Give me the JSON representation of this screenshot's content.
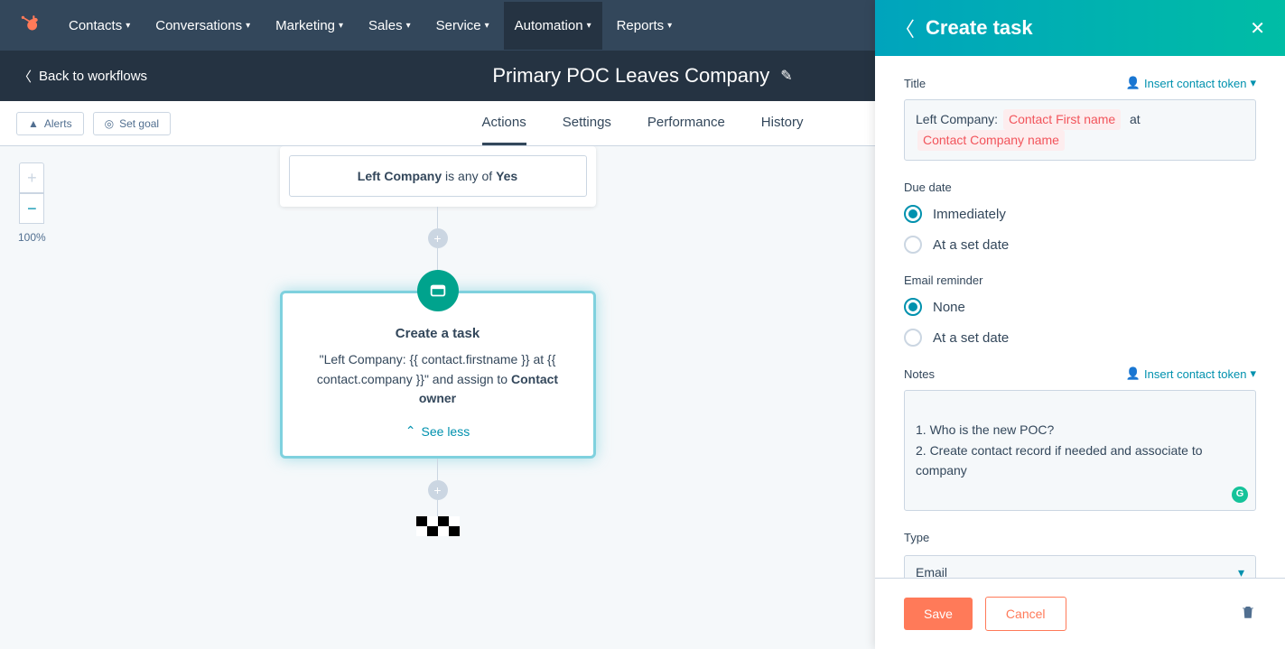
{
  "nav": {
    "items": [
      {
        "label": "Contacts"
      },
      {
        "label": "Conversations"
      },
      {
        "label": "Marketing"
      },
      {
        "label": "Sales"
      },
      {
        "label": "Service"
      },
      {
        "label": "Automation"
      },
      {
        "label": "Reports"
      }
    ]
  },
  "subheader": {
    "back": "Back to workflows",
    "title": "Primary POC Leaves Company"
  },
  "toolbar": {
    "alerts": "Alerts",
    "set_goal": "Set goal",
    "tabs": [
      {
        "label": "Actions"
      },
      {
        "label": "Settings"
      },
      {
        "label": "Performance"
      },
      {
        "label": "History"
      }
    ]
  },
  "zoom": {
    "pct": "100%"
  },
  "flow": {
    "trigger_prefix": "Left Company",
    "trigger_mid": " is any of ",
    "trigger_value": "Yes",
    "action_title": "Create a task",
    "action_quote": "\"Left Company: {{ contact.firstname }} at {{ contact.company }}\"",
    "action_mid": " and assign to ",
    "action_assignee": "Contact owner",
    "see_less": "See less"
  },
  "panel": {
    "title": "Create task",
    "title_label": "Title",
    "token_link": "Insert contact token",
    "title_field": {
      "prefix": "Left Company:",
      "token1": "Contact First name",
      "mid": "at",
      "token2": "Contact Company name"
    },
    "due_label": "Due date",
    "due_options": [
      {
        "label": "Immediately",
        "selected": true
      },
      {
        "label": "At a set date",
        "selected": false
      }
    ],
    "reminder_label": "Email reminder",
    "reminder_options": [
      {
        "label": "None",
        "selected": true
      },
      {
        "label": "At a set date",
        "selected": false
      }
    ],
    "notes_label": "Notes",
    "notes_value": "1. Who is the new POC?\n2. Create contact record if needed and associate to company",
    "type_label": "Type",
    "type_value": "Email",
    "save": "Save",
    "cancel": "Cancel"
  }
}
